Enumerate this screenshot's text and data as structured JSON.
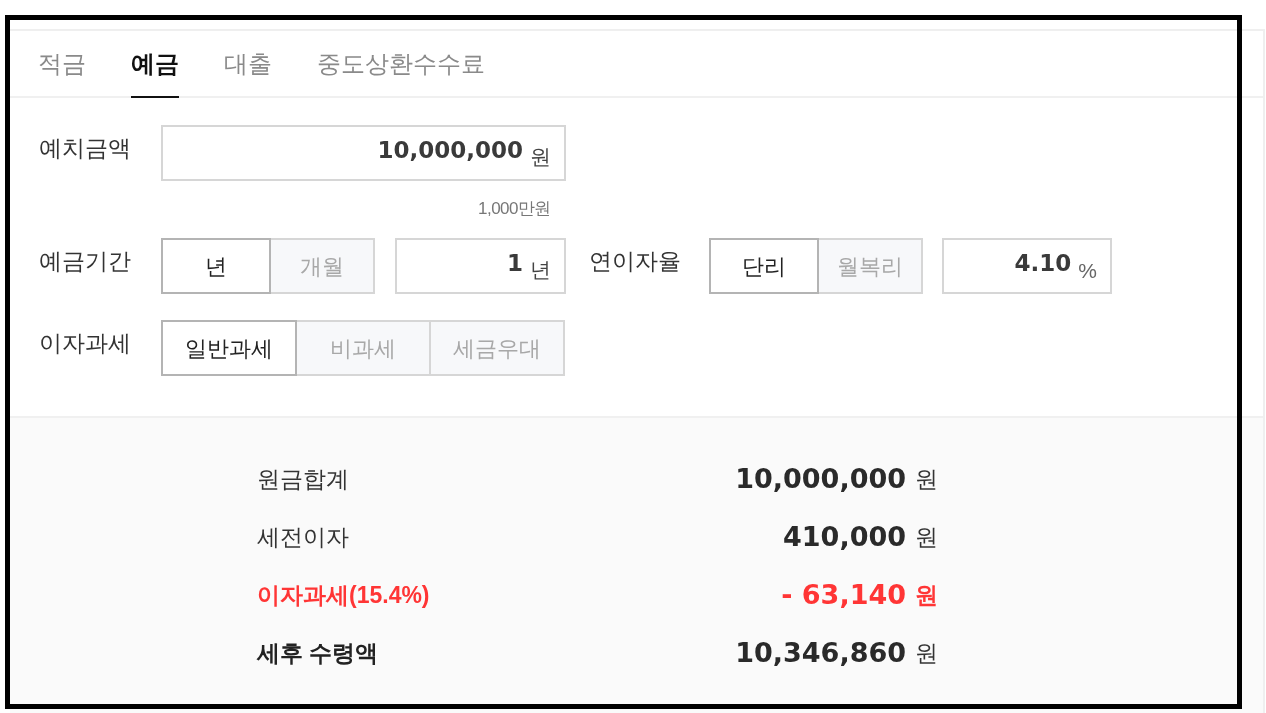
{
  "tabs": [
    {
      "label": "적금",
      "selected": false
    },
    {
      "label": "예금",
      "selected": true
    },
    {
      "label": "대출",
      "selected": false
    },
    {
      "label": "중도상환수수료",
      "selected": false
    }
  ],
  "form": {
    "deposit_amount": {
      "label": "예치금액",
      "value": "10,000,000",
      "unit": "원",
      "amount_in_words": "1,000만원"
    },
    "deposit_period": {
      "label": "예금기간",
      "options": [
        {
          "label": "년",
          "selected": true
        },
        {
          "label": "개월",
          "selected": false
        }
      ],
      "value": "1",
      "unit": "년"
    },
    "annual_rate": {
      "label": "연이자율",
      "options": [
        {
          "label": "단리",
          "selected": true
        },
        {
          "label": "월복리",
          "selected": false
        }
      ],
      "value": "4.10",
      "unit": "%"
    },
    "interest_tax": {
      "label": "이자과세",
      "options": [
        {
          "label": "일반과세",
          "selected": true
        },
        {
          "label": "비과세",
          "selected": false
        },
        {
          "label": "세금우대",
          "selected": false
        }
      ]
    }
  },
  "results": [
    {
      "kind": "normal",
      "label": "원금합계",
      "value": "10,000,000",
      "unit": "원"
    },
    {
      "kind": "normal",
      "label": "세전이자",
      "value": "410,000",
      "unit": "원"
    },
    {
      "kind": "deduction",
      "label": "이자과세(15.4%)",
      "value": "- 63,140",
      "unit": "원"
    },
    {
      "kind": "total",
      "label": "세후 수령액",
      "value": "10,346,860",
      "unit": "원"
    }
  ]
}
